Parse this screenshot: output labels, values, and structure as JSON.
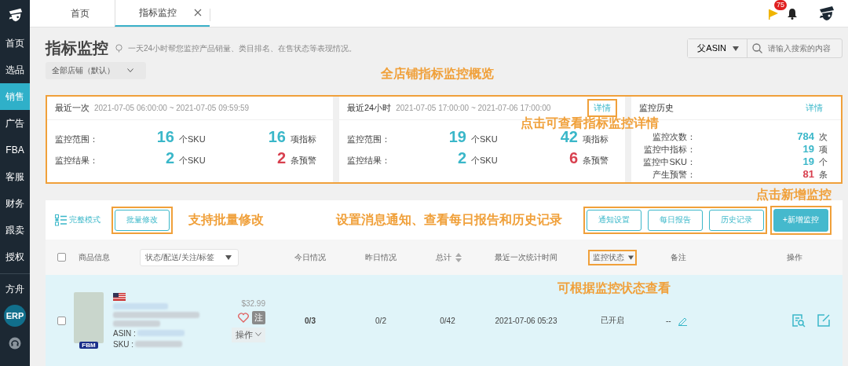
{
  "sidebar": {
    "sections": [
      {
        "items": [
          {
            "label": "首页",
            "selected": false,
            "kind": "text"
          },
          {
            "label": "选品",
            "selected": false,
            "kind": "text"
          },
          {
            "label": "销售",
            "selected": true,
            "kind": "text"
          },
          {
            "label": "广告",
            "selected": false,
            "kind": "text"
          },
          {
            "label": "FBA",
            "selected": false,
            "kind": "text"
          },
          {
            "label": "客服",
            "selected": false,
            "kind": "text"
          },
          {
            "label": "财务",
            "selected": false,
            "kind": "text"
          },
          {
            "label": "跟卖",
            "selected": false,
            "kind": "text"
          },
          {
            "label": "授权",
            "selected": false,
            "kind": "text"
          }
        ]
      },
      {
        "items": [
          {
            "label": "方舟",
            "selected": false,
            "kind": "text"
          },
          {
            "label": "ERP",
            "selected": false,
            "kind": "badge"
          }
        ]
      }
    ]
  },
  "tabs": [
    {
      "label": "首页",
      "selected": false,
      "closable": false
    },
    {
      "label": "指标监控",
      "selected": true,
      "closable": true
    }
  ],
  "header": {
    "flag_badge": "75"
  },
  "page": {
    "title": "指标监控",
    "subtitle": "一天24小时帮您监控产品销量、类目排名、在售状态等表现情况。",
    "store_select": "全部店铺（默认）",
    "search": {
      "scope": "父ASIN",
      "placeholder": "请输入搜索的内容"
    }
  },
  "overview": {
    "annotation": "全店铺指标监控概览",
    "detail_annotation": "点击可查看指标监控详情",
    "highlighted": true,
    "cards": [
      {
        "kind": "summary",
        "title": "最近一次",
        "range": "2021-07-05 06:00:00 ~ 2021-07-05 09:59:59",
        "rows": [
          {
            "label": "监控范围：",
            "stats": [
              {
                "value": "16",
                "unit": "个SKU",
                "alert": false
              },
              {
                "value": "16",
                "unit": "项指标",
                "alert": false
              }
            ]
          },
          {
            "label": "监控结果：",
            "stats": [
              {
                "value": "2",
                "unit": "个SKU",
                "alert": false
              },
              {
                "value": "2",
                "unit": "条预警",
                "alert": true
              }
            ]
          }
        ]
      },
      {
        "kind": "summary",
        "title": "最近24小时",
        "range": "2021-07-05 17:00:00 ~ 2021-07-06 17:00:00",
        "detail": {
          "label": "详情",
          "highlighted": true
        },
        "rows": [
          {
            "label": "监控范围：",
            "stats": [
              {
                "value": "19",
                "unit": "个SKU",
                "alert": false
              },
              {
                "value": "42",
                "unit": "项指标",
                "alert": false
              }
            ]
          },
          {
            "label": "监控结果：",
            "stats": [
              {
                "value": "2",
                "unit": "个SKU",
                "alert": false
              },
              {
                "value": "6",
                "unit": "条预警",
                "alert": true
              }
            ]
          }
        ]
      },
      {
        "kind": "history",
        "title": "监控历史",
        "detail": {
          "label": "详情",
          "highlighted": false
        },
        "rows": [
          {
            "label": "监控次数：",
            "value": "784",
            "unit": "次",
            "alert": false
          },
          {
            "label": "监控中指标：",
            "value": "19",
            "unit": "项",
            "alert": false
          },
          {
            "label": "监控中SKU：",
            "value": "19",
            "unit": "个",
            "alert": false
          },
          {
            "label": "产生预警：",
            "value": "81",
            "unit": "条",
            "alert": true
          }
        ]
      }
    ]
  },
  "toolbar": {
    "view_mode": "完整模式",
    "batch_button": {
      "label": "批量修改",
      "highlighted": true
    },
    "annotations": [
      "支持批量修改",
      "设置消息通知、查看每日报告和历史记录"
    ],
    "actions_highlighted": true,
    "actions": [
      {
        "label": "通知设置"
      },
      {
        "label": "每日报告"
      },
      {
        "label": "历史记录"
      }
    ],
    "primary": {
      "label": "+新增监控",
      "highlighted": true,
      "annotation": "点击新增监控"
    }
  },
  "table": {
    "select_all_checked": false,
    "product_column": "商品信息",
    "filter": "状态/配送/关注/标签",
    "columns": [
      {
        "label": "今日情况",
        "sortable": false,
        "filterable": false,
        "highlighted": false
      },
      {
        "label": "昨日情况",
        "sortable": false,
        "filterable": false,
        "highlighted": false
      },
      {
        "label": "总计",
        "sortable": true,
        "filterable": false,
        "highlighted": false
      },
      {
        "label": "最近一次统计时间",
        "sortable": false,
        "filterable": false,
        "highlighted": false
      },
      {
        "label": "监控状态",
        "sortable": false,
        "filterable": true,
        "highlighted": true
      },
      {
        "label": "备注",
        "sortable": false,
        "filterable": false,
        "highlighted": false
      },
      {
        "label": "操作",
        "sortable": false,
        "filterable": false,
        "highlighted": false
      }
    ],
    "status_annotation": "可根据监控状态查看",
    "rows": [
      {
        "checked": false,
        "fulfillment": "FBM",
        "asin_label": "ASIN :",
        "sku_label": "SKU :",
        "price": "$32.99",
        "favorite": false,
        "note_badge": "注",
        "action_menu": "操作",
        "today": "0/3",
        "yesterday": "0/2",
        "total": "0/42",
        "last_time": "2021-07-06 05:23",
        "status": "已开启",
        "remark": "--"
      }
    ]
  }
}
